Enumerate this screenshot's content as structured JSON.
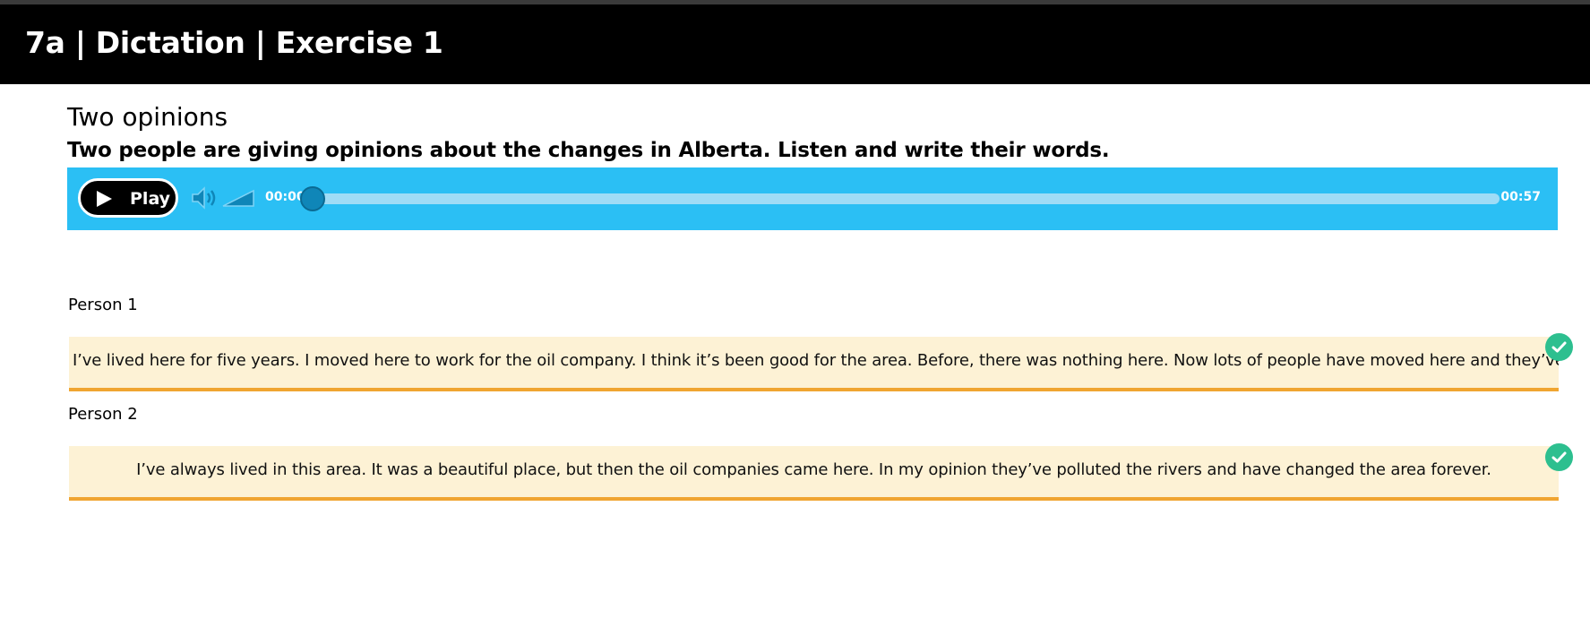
{
  "header": {
    "title": "7a | Dictation | Exercise 1"
  },
  "exercise": {
    "title": "Two opinions",
    "instructions": "Two people are giving opinions about the changes in Alberta. Listen and write their words."
  },
  "player": {
    "play_label": "Play",
    "current_time": "00:00",
    "total_time": "00:57",
    "progress": 0,
    "bg_color": "#2bbff4",
    "icons": [
      "play-icon",
      "volume-icon",
      "volume-slider-icon"
    ]
  },
  "answers": [
    {
      "label": "Person 1",
      "value": "I’ve lived here for five years. I moved here to work for the oil company. I think it’s been good for the area. Before, there was nothing here. Now lots of people have moved here and they’ve built new tow",
      "status": "correct",
      "status_icon": "check-icon"
    },
    {
      "label": "Person 2",
      "value": "I’ve always lived in this area. It was a beautiful place, but then the oil companies came here. In my opinion they’ve polluted the rivers and have changed the area forever.",
      "status": "correct",
      "status_icon": "check-icon"
    }
  ],
  "colors": {
    "header_bg": "#000000",
    "answer_bg": "#fdf2d5",
    "answer_underline": "#f0a531",
    "correct": "#2dbf8f"
  }
}
